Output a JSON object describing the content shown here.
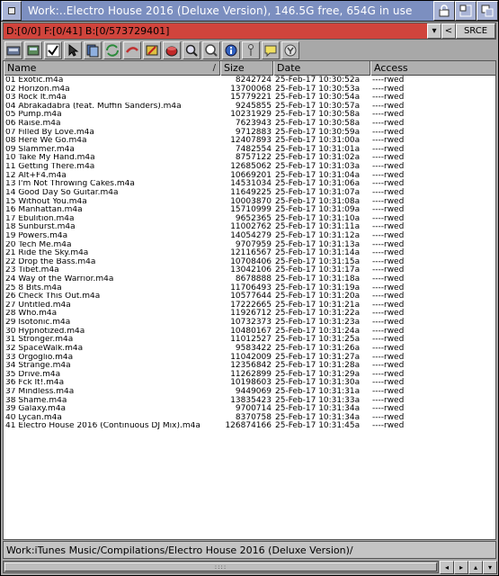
{
  "window": {
    "title": "Work:..Electro House 2016 (Deluxe Version),  146.5G free, 654G in use"
  },
  "statusbar": {
    "text": "D:[0/0] F:[0/41] B:[0/573729401]",
    "arrow": "▾",
    "back": "<",
    "source": "SRCE"
  },
  "toolbar": {
    "icons": [
      "drive-icon",
      "parent-icon",
      "select-all-icon",
      "pointer-icon",
      "copy-icon",
      "refresh-icon",
      "move-icon",
      "rename-icon",
      "delete-icon",
      "find-icon",
      "search-icon",
      "info-icon",
      "tools-icon",
      "comment-icon",
      "filter-icon"
    ]
  },
  "columns": {
    "name": "Name",
    "size": "Size",
    "date": "Date",
    "access": "Access",
    "sort_indicator": "/"
  },
  "files": [
    {
      "name": "01 Exotic.m4a",
      "size": "8242724",
      "date": "25-Feb-17 10:30:52a",
      "access": "----rwed"
    },
    {
      "name": "02 Horizon.m4a",
      "size": "13700068",
      "date": "25-Feb-17 10:30:53a",
      "access": "----rwed"
    },
    {
      "name": "03 Rock It.m4a",
      "size": "15779221",
      "date": "25-Feb-17 10:30:54a",
      "access": "----rwed"
    },
    {
      "name": "04 Abrakadabra (feat. Muffin Sanders).m4a",
      "size": "9245855",
      "date": "25-Feb-17 10:30:57a",
      "access": "----rwed"
    },
    {
      "name": "05 Pump.m4a",
      "size": "10231929",
      "date": "25-Feb-17 10:30:58a",
      "access": "----rwed"
    },
    {
      "name": "06 Raise.m4a",
      "size": "7623943",
      "date": "25-Feb-17 10:30:58a",
      "access": "----rwed"
    },
    {
      "name": "07 Filled By Love.m4a",
      "size": "9712883",
      "date": "25-Feb-17 10:30:59a",
      "access": "----rwed"
    },
    {
      "name": "08 Here We Go.m4a",
      "size": "12407893",
      "date": "25-Feb-17 10:31:00a",
      "access": "----rwed"
    },
    {
      "name": "09 Slammer.m4a",
      "size": "7482554",
      "date": "25-Feb-17 10:31:01a",
      "access": "----rwed"
    },
    {
      "name": "10 Take My Hand.m4a",
      "size": "8757122",
      "date": "25-Feb-17 10:31:02a",
      "access": "----rwed"
    },
    {
      "name": "11 Getting There.m4a",
      "size": "12685062",
      "date": "25-Feb-17 10:31:03a",
      "access": "----rwed"
    },
    {
      "name": "12 Alt+F4.m4a",
      "size": "10669201",
      "date": "25-Feb-17 10:31:04a",
      "access": "----rwed"
    },
    {
      "name": "13 I'm Not Throwing Cakes.m4a",
      "size": "14531034",
      "date": "25-Feb-17 10:31:06a",
      "access": "----rwed"
    },
    {
      "name": "14 Good Day So Guitar.m4a",
      "size": "11649225",
      "date": "25-Feb-17 10:31:07a",
      "access": "----rwed"
    },
    {
      "name": "15 Without You.m4a",
      "size": "10003870",
      "date": "25-Feb-17 10:31:08a",
      "access": "----rwed"
    },
    {
      "name": "16 Manhattan.m4a",
      "size": "15710999",
      "date": "25-Feb-17 10:31:09a",
      "access": "----rwed"
    },
    {
      "name": "17 Ebulition.m4a",
      "size": "9652365",
      "date": "25-Feb-17 10:31:10a",
      "access": "----rwed"
    },
    {
      "name": "18 Sunburst.m4a",
      "size": "11002762",
      "date": "25-Feb-17 10:31:11a",
      "access": "----rwed"
    },
    {
      "name": "19 Powers.m4a",
      "size": "14054279",
      "date": "25-Feb-17 10:31:12a",
      "access": "----rwed"
    },
    {
      "name": "20 Tech Me.m4a",
      "size": "9707959",
      "date": "25-Feb-17 10:31:13a",
      "access": "----rwed"
    },
    {
      "name": "21 Ride the Sky.m4a",
      "size": "12116567",
      "date": "25-Feb-17 10:31:14a",
      "access": "----rwed"
    },
    {
      "name": "22 Drop the Bass.m4a",
      "size": "10708406",
      "date": "25-Feb-17 10:31:15a",
      "access": "----rwed"
    },
    {
      "name": "23 Tibet.m4a",
      "size": "13042106",
      "date": "25-Feb-17 10:31:17a",
      "access": "----rwed"
    },
    {
      "name": "24 Way of the Warrior.m4a",
      "size": "8678888",
      "date": "25-Feb-17 10:31:18a",
      "access": "----rwed"
    },
    {
      "name": "25 8 Bits.m4a",
      "size": "11706493",
      "date": "25-Feb-17 10:31:19a",
      "access": "----rwed"
    },
    {
      "name": "26 Check This Out.m4a",
      "size": "10577644",
      "date": "25-Feb-17 10:31:20a",
      "access": "----rwed"
    },
    {
      "name": "27 Untitled.m4a",
      "size": "17222665",
      "date": "25-Feb-17 10:31:21a",
      "access": "----rwed"
    },
    {
      "name": "28 Who.m4a",
      "size": "11926712",
      "date": "25-Feb-17 10:31:22a",
      "access": "----rwed"
    },
    {
      "name": "29 Isotonic.m4a",
      "size": "10732373",
      "date": "25-Feb-17 10:31:23a",
      "access": "----rwed"
    },
    {
      "name": "30 Hypnotized.m4a",
      "size": "10480167",
      "date": "25-Feb-17 10:31:24a",
      "access": "----rwed"
    },
    {
      "name": "31 Stronger.m4a",
      "size": "11012527",
      "date": "25-Feb-17 10:31:25a",
      "access": "----rwed"
    },
    {
      "name": "32 SpaceWalk.m4a",
      "size": "9583422",
      "date": "25-Feb-17 10:31:26a",
      "access": "----rwed"
    },
    {
      "name": "33 Orgoglio.m4a",
      "size": "11042009",
      "date": "25-Feb-17 10:31:27a",
      "access": "----rwed"
    },
    {
      "name": "34 Strange.m4a",
      "size": "12356842",
      "date": "25-Feb-17 10:31:28a",
      "access": "----rwed"
    },
    {
      "name": "35 Drive.m4a",
      "size": "11262899",
      "date": "25-Feb-17 10:31:29a",
      "access": "----rwed"
    },
    {
      "name": "36 Fck It!.m4a",
      "size": "10198603",
      "date": "25-Feb-17 10:31:30a",
      "access": "----rwed"
    },
    {
      "name": "37 Mindless.m4a",
      "size": "9449069",
      "date": "25-Feb-17 10:31:31a",
      "access": "----rwed"
    },
    {
      "name": "38 Shame.m4a",
      "size": "13835423",
      "date": "25-Feb-17 10:31:33a",
      "access": "----rwed"
    },
    {
      "name": "39 Galaxy.m4a",
      "size": "9700714",
      "date": "25-Feb-17 10:31:34a",
      "access": "----rwed"
    },
    {
      "name": "40 Lycan.m4a",
      "size": "8370758",
      "date": "25-Feb-17 10:31:34a",
      "access": "----rwed"
    },
    {
      "name": "41 Electro House 2016 (Continuous DJ Mix).m4a",
      "size": "126874166",
      "date": "25-Feb-17 10:31:45a",
      "access": "----rwed"
    }
  ],
  "pathbar": {
    "path": "Work:iTunes Music/Compilations/Electro House 2016 (Deluxe Version)/"
  },
  "bottombar": {
    "grip": "::::",
    "left": "◂",
    "right": "▸",
    "up": "▴",
    "down": "▾"
  }
}
